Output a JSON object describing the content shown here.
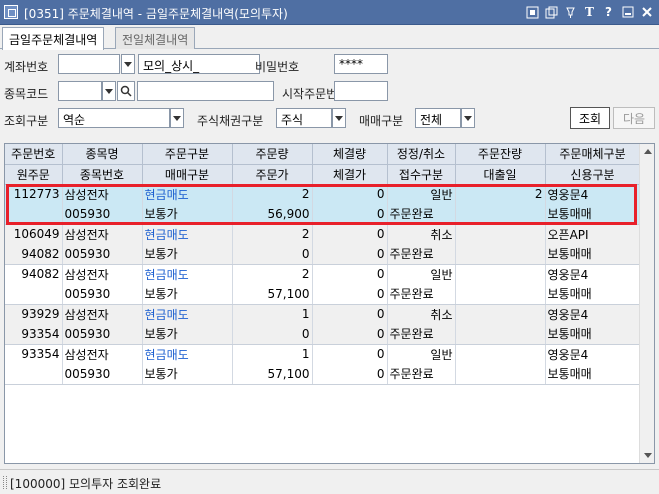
{
  "window": {
    "title": "[0351] 주문체결내역 - 금일주문체결내역(모의투자)",
    "title_icons": [
      "link-icon",
      "copy-icon",
      "pin-icon",
      "font-icon",
      "help-icon",
      "minimize-icon",
      "close-icon"
    ],
    "title_glyphs": {
      "font": "T",
      "help": "?"
    }
  },
  "tabs": [
    {
      "label": "금일주문체결내역",
      "active": true
    },
    {
      "label": "전일체결내역",
      "active": false
    }
  ],
  "form": {
    "account_label": "계좌번호",
    "account_value": "",
    "account_name": "모의_상시_",
    "password_label": "비밀번호",
    "password_value": "****",
    "stock_code_label": "종목코드",
    "stock_code_value": "",
    "stock_name_value": "",
    "start_order_label": "시작주문번호",
    "start_order_value": "",
    "query_type_label": "조회구분",
    "query_type_value": "역순",
    "security_type_label": "주식채권구분",
    "security_type_value": "주식",
    "trade_type_label": "매매구분",
    "trade_type_value": "전체",
    "search_button": "조회",
    "next_button": "다음"
  },
  "table": {
    "header_row1": [
      "주문번호",
      "종목명",
      "주문구분",
      "주문량",
      "체결량",
      "정정/취소",
      "주문잔량",
      "주문매체구분"
    ],
    "header_row2": [
      "원주문",
      "종목번호",
      "매매구분",
      "주문가",
      "체결가",
      "접수구분",
      "대출일",
      "신용구분"
    ],
    "orders": [
      {
        "order_no": "112773",
        "orig_no": "",
        "name": "삼성전자",
        "code": "005930",
        "side": "현금매도",
        "order_type": "보통가",
        "qty": "2",
        "price": "56,900",
        "exec_qty": "0",
        "exec_price": "0",
        "mod": "일반",
        "status": "주문완료",
        "remain": "2",
        "loan_date": "",
        "media": "영웅문4",
        "credit": "보통매매",
        "selected": true
      },
      {
        "order_no": "106049",
        "orig_no": "94082",
        "name": "삼성전자",
        "code": "005930",
        "side": "현금매도",
        "order_type": "보통가",
        "qty": "2",
        "price": "0",
        "exec_qty": "0",
        "exec_price": "0",
        "mod": "취소",
        "status": "주문완료",
        "remain": "",
        "loan_date": "",
        "media": "오픈API",
        "credit": "보통매매",
        "selected": false
      },
      {
        "order_no": "94082",
        "orig_no": "",
        "name": "삼성전자",
        "code": "005930",
        "side": "현금매도",
        "order_type": "보통가",
        "qty": "2",
        "price": "57,100",
        "exec_qty": "0",
        "exec_price": "0",
        "mod": "일반",
        "status": "주문완료",
        "remain": "",
        "loan_date": "",
        "media": "영웅문4",
        "credit": "보통매매",
        "selected": false
      },
      {
        "order_no": "93929",
        "orig_no": "93354",
        "name": "삼성전자",
        "code": "005930",
        "side": "현금매도",
        "order_type": "보통가",
        "qty": "1",
        "price": "0",
        "exec_qty": "0",
        "exec_price": "0",
        "mod": "취소",
        "status": "주문완료",
        "remain": "",
        "loan_date": "",
        "media": "영웅문4",
        "credit": "보통매매",
        "selected": false
      },
      {
        "order_no": "93354",
        "orig_no": "",
        "name": "삼성전자",
        "code": "005930",
        "side": "현금매도",
        "order_type": "보통가",
        "qty": "1",
        "price": "57,100",
        "exec_qty": "0",
        "exec_price": "0",
        "mod": "일반",
        "status": "주문완료",
        "remain": "",
        "loan_date": "",
        "media": "영웅문4",
        "credit": "보통매매",
        "selected": false
      }
    ]
  },
  "status_bar": {
    "text": "[100000] 모의투자 조회완료"
  },
  "colors": {
    "titlebar": "#4f6fa3",
    "selected_row": "#cbe8f4",
    "highlight_box": "#e8202a",
    "side_text": "#1c5fd0"
  }
}
